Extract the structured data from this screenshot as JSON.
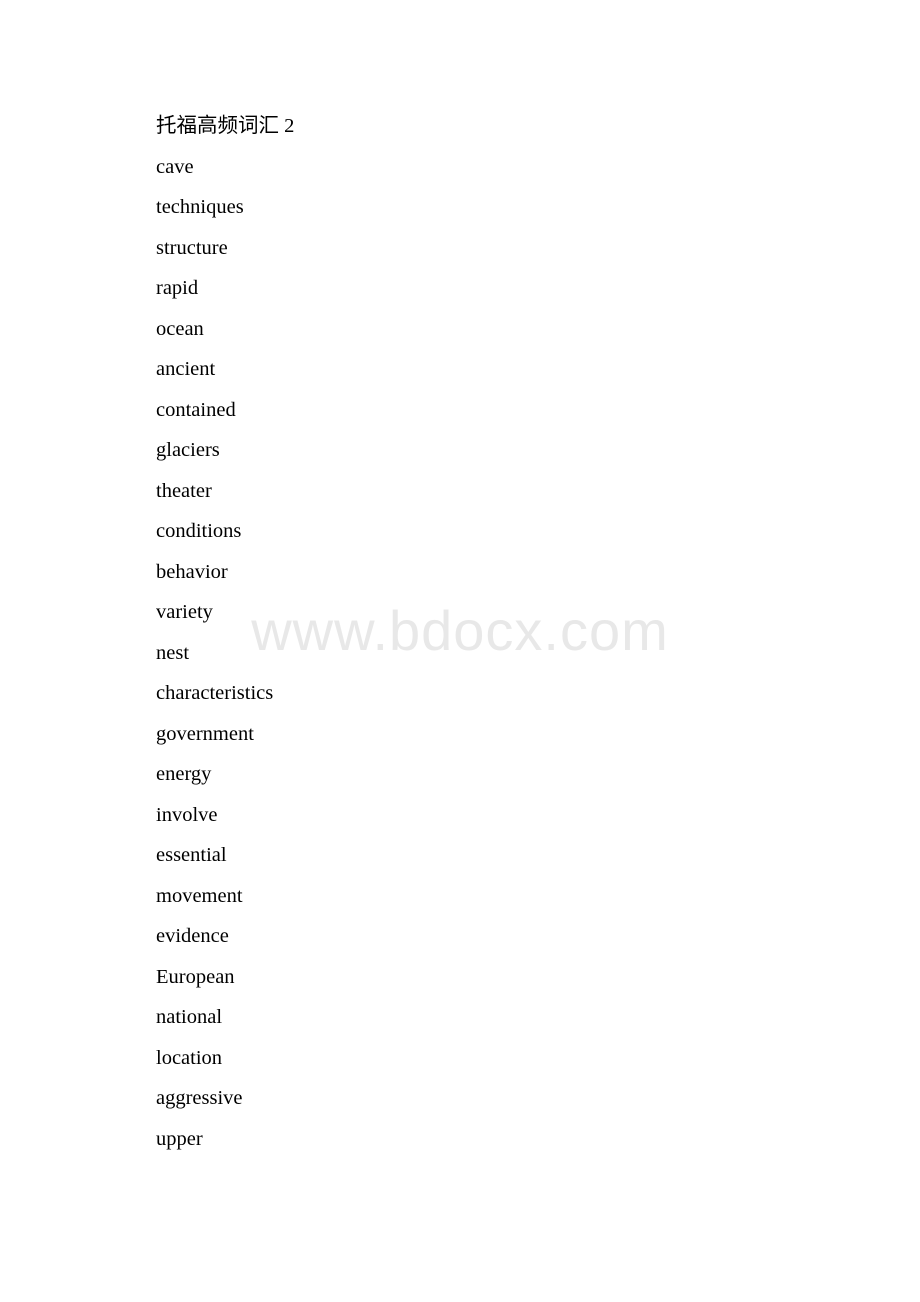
{
  "document": {
    "title": "托福高频词汇 2",
    "watermark": "www.bdocx.com",
    "watermark_color": "#e8e8e8",
    "text_color": "#000000",
    "background_color": "#ffffff",
    "words": [
      "cave",
      "techniques",
      "structure",
      "rapid",
      "ocean",
      "ancient",
      "contained",
      "glaciers",
      "theater",
      "conditions",
      "behavior",
      "variety",
      "nest",
      "characteristics",
      "government",
      "energy",
      "involve",
      "essential",
      "movement",
      "evidence",
      "European",
      "national",
      "location",
      "aggressive",
      "upper"
    ]
  }
}
